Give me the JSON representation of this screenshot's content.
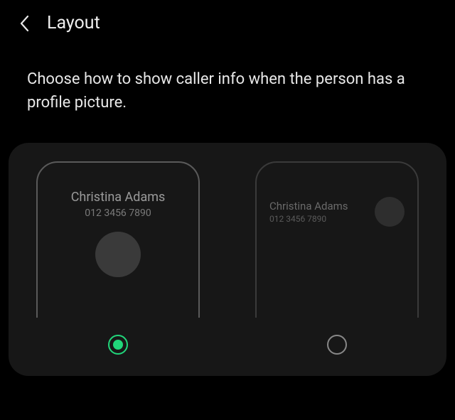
{
  "header": {
    "title": "Layout"
  },
  "description": "Choose how to show caller info when the person has a profile picture.",
  "options": {
    "center": {
      "caller_name": "Christina Adams",
      "caller_number": "012 3456 7890",
      "selected": true
    },
    "compact": {
      "caller_name": "Christina Adams",
      "caller_number": "012 3456 7890",
      "selected": false
    }
  },
  "colors": {
    "accent": "#21d67a",
    "background": "#000000",
    "panel": "#171717"
  }
}
